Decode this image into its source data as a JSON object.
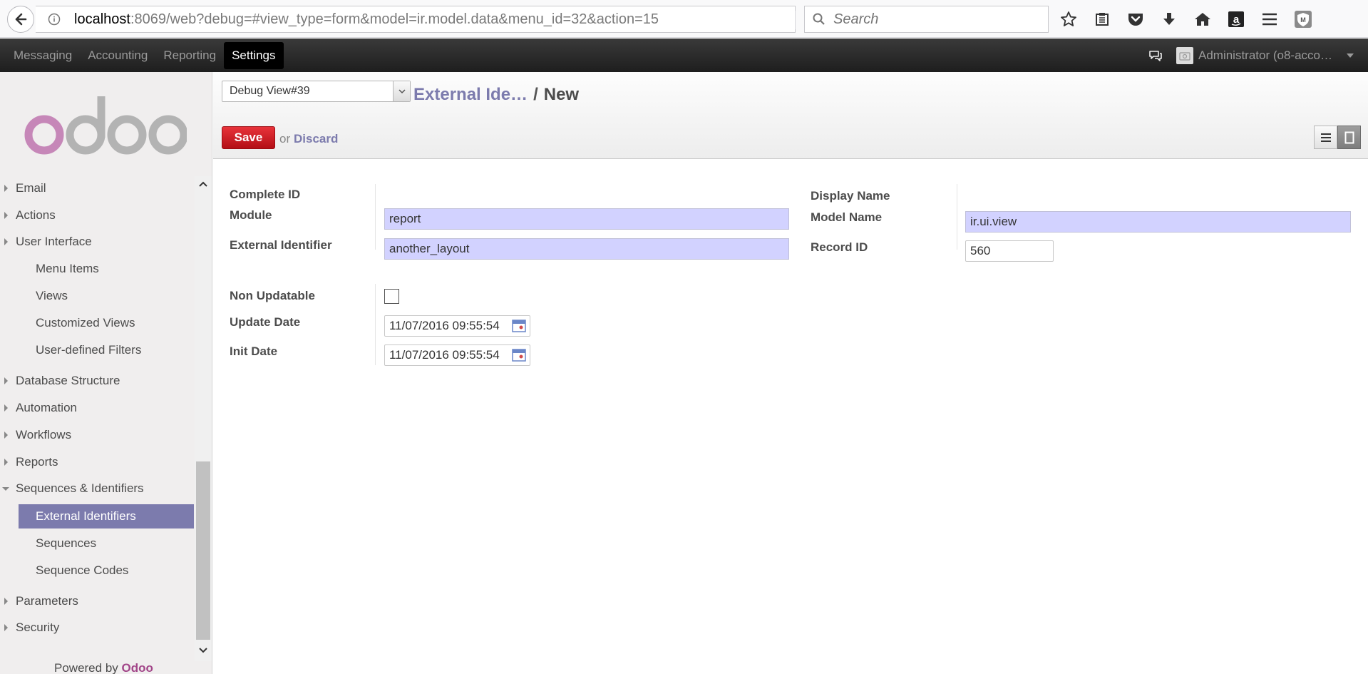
{
  "browser": {
    "url_host": "localhost",
    "url_rest": ":8069/web?debug=#view_type=form&model=ir.model.data&menu_id=32&action=15",
    "search_placeholder": "Search"
  },
  "topmenu": {
    "items": [
      "Messaging",
      "Accounting",
      "Reporting",
      "Settings"
    ],
    "active": "Settings",
    "user": "Administrator (o8-acco…"
  },
  "sidebar": {
    "items": [
      {
        "label": "Email",
        "level": 1,
        "arrow": "right"
      },
      {
        "label": "Actions",
        "level": 1,
        "arrow": "right"
      },
      {
        "label": "User Interface",
        "level": 1,
        "arrow": "right"
      },
      {
        "label": "Menu Items",
        "level": 2
      },
      {
        "label": "Views",
        "level": 2
      },
      {
        "label": "Customized Views",
        "level": 2
      },
      {
        "label": "User-defined Filters",
        "level": 2
      },
      {
        "label": "Database Structure",
        "level": 1,
        "arrow": "right"
      },
      {
        "label": "Automation",
        "level": 1,
        "arrow": "right"
      },
      {
        "label": "Workflows",
        "level": 1,
        "arrow": "right"
      },
      {
        "label": "Reports",
        "level": 1,
        "arrow": "right"
      },
      {
        "label": "Sequences & Identifiers",
        "level": 1,
        "arrow": "down"
      },
      {
        "label": "External Identifiers",
        "level": 2,
        "active": true
      },
      {
        "label": "Sequences",
        "level": 2
      },
      {
        "label": "Sequence Codes",
        "level": 2
      },
      {
        "label": "Parameters",
        "level": 1,
        "arrow": "right"
      },
      {
        "label": "Security",
        "level": 1,
        "arrow": "right"
      }
    ],
    "powered_prefix": "Powered by ",
    "powered_brand": "Odoo"
  },
  "header": {
    "debug_view": "Debug View#39",
    "breadcrumb_parent": "External Ide…",
    "breadcrumb_sep": "/",
    "breadcrumb_current": "New",
    "save_label": "Save",
    "or_label": "or",
    "discard_label": "Discard"
  },
  "form": {
    "complete_id_label": "Complete ID",
    "module_label": "Module",
    "module_value": "report",
    "external_identifier_label": "External Identifier",
    "external_identifier_value": "another_layout",
    "display_name_label": "Display Name",
    "model_name_label": "Model Name",
    "model_name_value": "ir.ui.view",
    "record_id_label": "Record ID",
    "record_id_value": "560",
    "non_updatable_label": "Non Updatable",
    "update_date_label": "Update Date",
    "update_date_value": "11/07/2016 09:55:54",
    "init_date_label": "Init Date",
    "init_date_value": "11/07/2016 09:55:54"
  },
  "colors": {
    "accent": "#7c7bad",
    "save": "#d9232a",
    "readonly_bg": "#d2d2ff",
    "brand": "#a24689"
  }
}
